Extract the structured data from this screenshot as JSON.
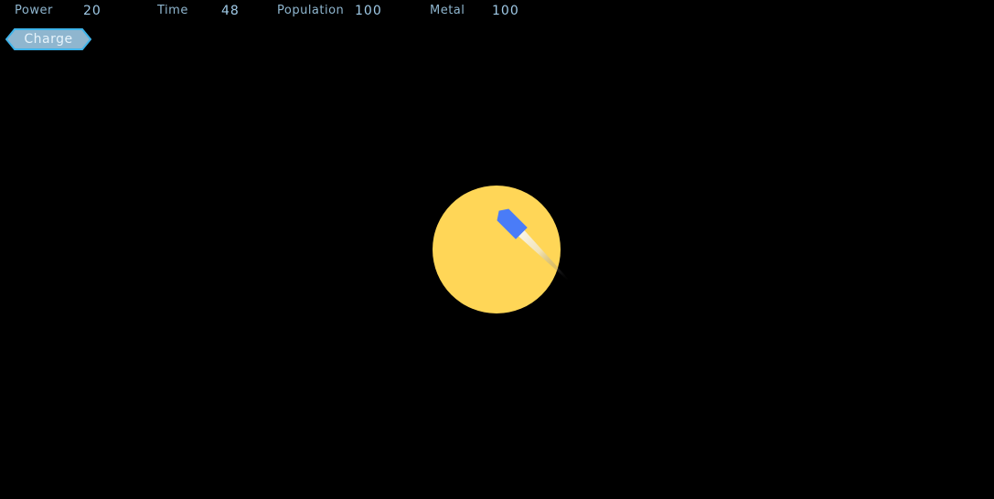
{
  "hud": {
    "power_label": "Power",
    "power_value": "20",
    "time_label": "Time",
    "time_value": "48",
    "population_label": "Population",
    "population_value": "100",
    "metal_label": "Metal",
    "metal_value": "100"
  },
  "actions": {
    "charge_label": "Charge"
  },
  "colors": {
    "background": "#000000",
    "planet": "#ffd657",
    "ship": "#4a7cf7",
    "hud_text": "#8fb6cf",
    "button_fill": "#8fb6cf",
    "button_border": "#3fb4ea"
  },
  "icons": {
    "planet": "planet-icon",
    "ship": "rocket-icon"
  }
}
